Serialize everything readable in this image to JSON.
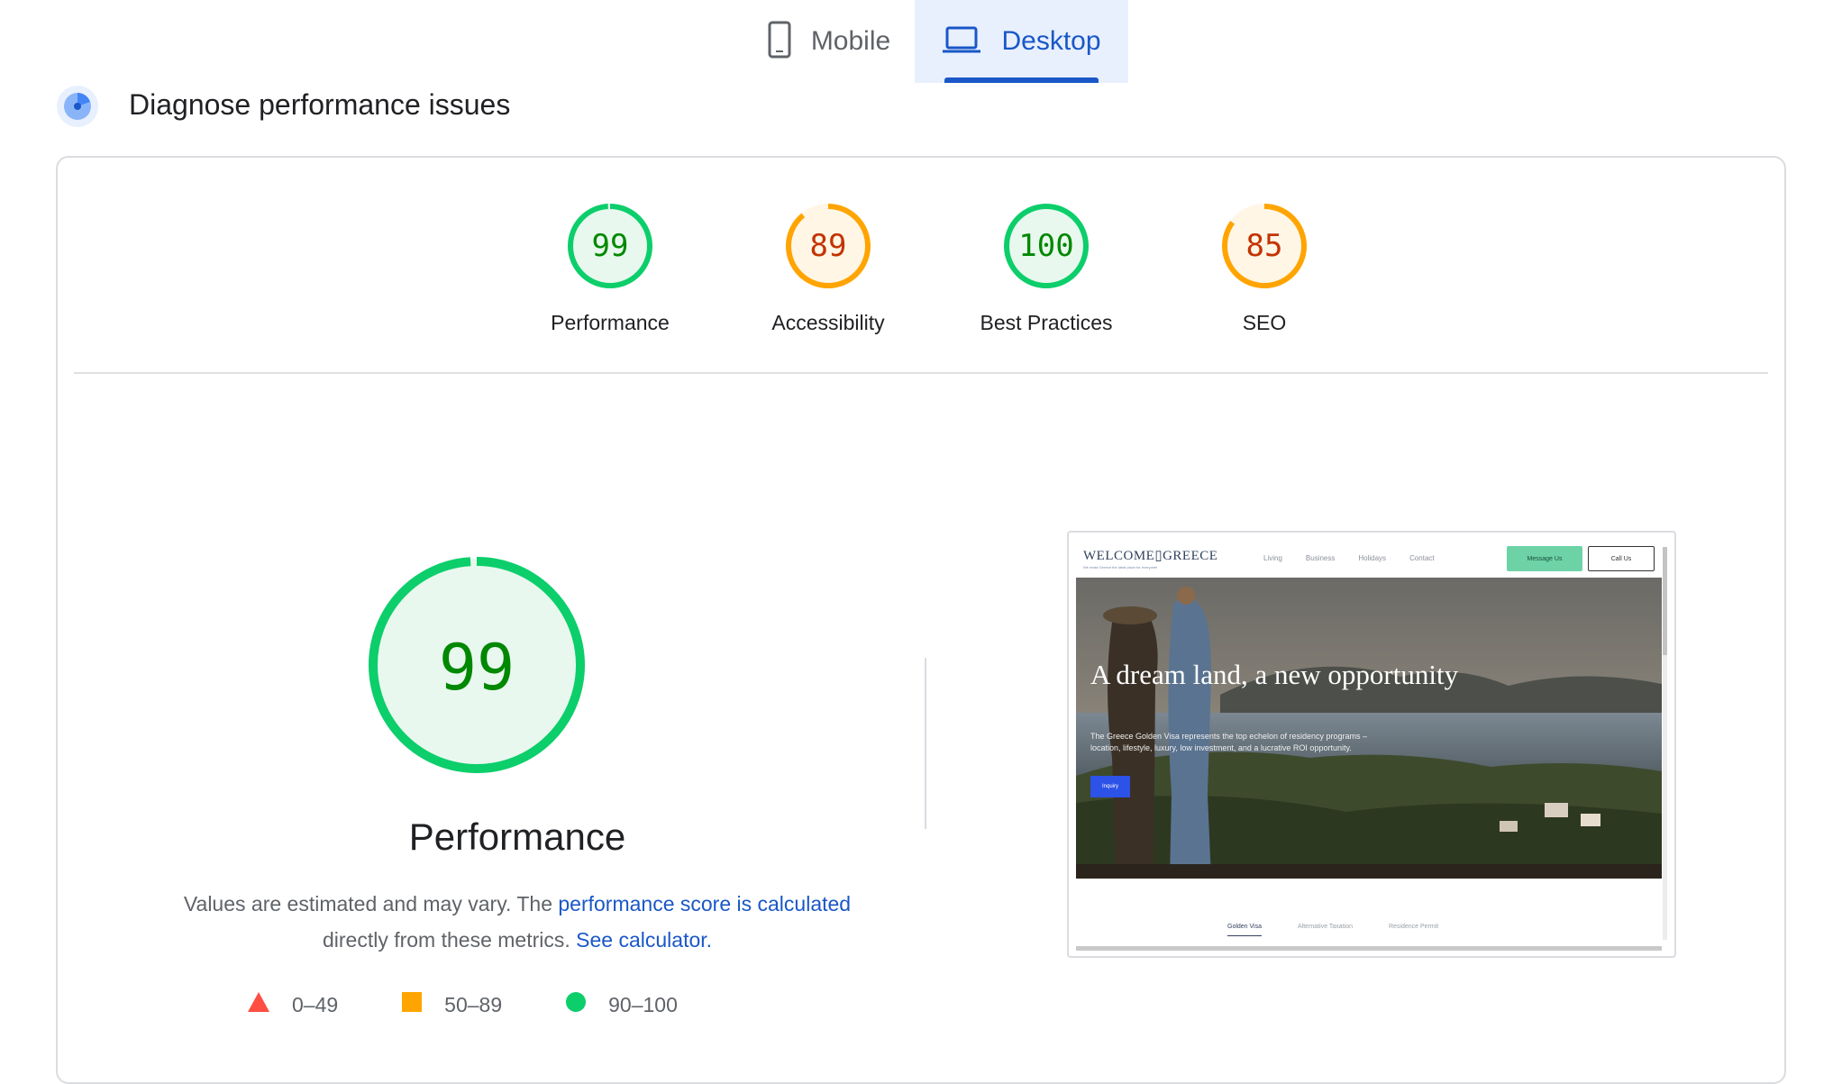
{
  "device_tabs": {
    "mobile_label": "Mobile",
    "desktop_label": "Desktop",
    "selected": "Desktop"
  },
  "diagnose": {
    "title": "Diagnose performance issues"
  },
  "categories": [
    {
      "score": 99,
      "label": "Performance",
      "status": "pass"
    },
    {
      "score": 89,
      "label": "Accessibility",
      "status": "average"
    },
    {
      "score": 100,
      "label": "Best Practices",
      "status": "pass"
    },
    {
      "score": 85,
      "label": "SEO",
      "status": "average"
    }
  ],
  "main": {
    "score": 99,
    "title": "Performance",
    "desc_prefix": "Values are estimated and may vary. The ",
    "desc_link1": "performance score is calculated",
    "desc_middle": " directly from these metrics. ",
    "desc_link2": "See calculator."
  },
  "legend": [
    {
      "range": "0–49",
      "shape": "triangle",
      "color": "#ff4e42"
    },
    {
      "range": "50–89",
      "shape": "square",
      "color": "#ffa400"
    },
    {
      "range": "90–100",
      "shape": "circle",
      "color": "#0cce6b"
    }
  ],
  "colors": {
    "pass": "#0cce6b",
    "pass_text": "#008800",
    "average": "#ffa400",
    "average_text": "#c33300",
    "accent": "#1a57c7"
  },
  "screenshot": {
    "logo": "WELCOME▯GREECE",
    "tagline": "We make Greece the ideal place for everyone!",
    "nav": [
      "Living",
      "Business",
      "Holidays",
      "Contact"
    ],
    "message_button": "Message Us",
    "call_button": "Call Us",
    "hero_title": "A dream land, a new opportunity",
    "hero_text": "The Greece Golden Visa represents the top echelon of residency programs – location, lifestyle, luxury, low investment, and a lucrative ROI opportunity.",
    "hero_button": "Inquiry",
    "tabs": [
      "Golden Visa",
      "Alternative Taxation",
      "Residence Permit"
    ]
  }
}
